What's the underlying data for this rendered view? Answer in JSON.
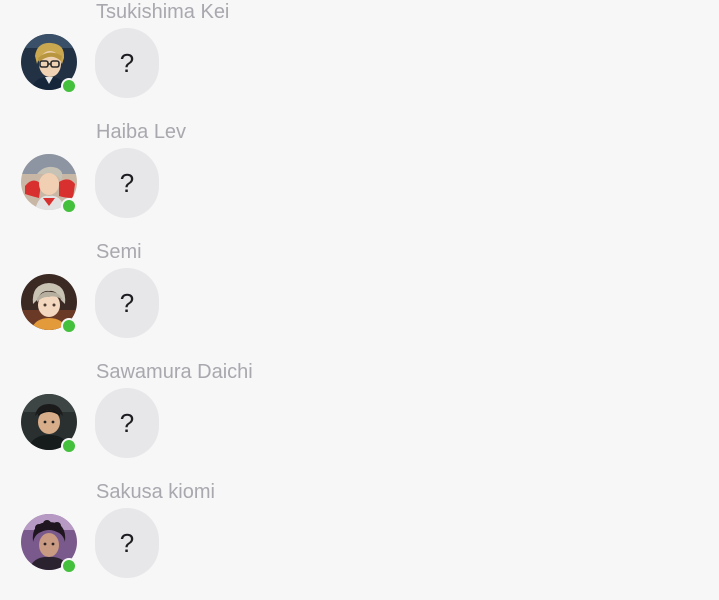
{
  "colors": {
    "background": "#f7f7f8",
    "name_text": "#a8a8ae",
    "bubble": "#e7e7e9",
    "online": "#44c03d"
  },
  "messages": [
    {
      "sender": "Tsukishima Kei",
      "text": "?",
      "online": true,
      "avatar_icon": "user-avatar"
    },
    {
      "sender": "Haiba Lev",
      "text": "?",
      "online": true,
      "avatar_icon": "user-avatar"
    },
    {
      "sender": "Semi",
      "text": "?",
      "online": true,
      "avatar_icon": "user-avatar"
    },
    {
      "sender": "Sawamura Daichi",
      "text": "?",
      "online": true,
      "avatar_icon": "user-avatar"
    },
    {
      "sender": "Sakusa kiomi",
      "text": "?",
      "online": true,
      "avatar_icon": "user-avatar"
    }
  ]
}
